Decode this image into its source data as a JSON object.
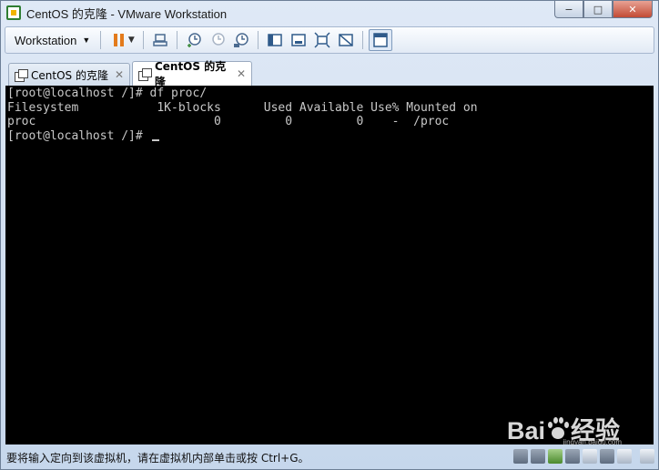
{
  "window": {
    "title": "CentOS 的克隆 - VMware Workstation",
    "controls": {
      "minimize": "−",
      "maximize": "□",
      "close": "✕"
    }
  },
  "toolbar": {
    "menu_label": "Workstation",
    "icons": [
      "pause-icon",
      "send-keys-icon",
      "snapshot-take-icon",
      "snapshot-revert-icon",
      "snapshot-manager-icon",
      "view-normal-icon",
      "view-fullscreen-bar-icon",
      "view-fit-icon",
      "view-unity-icon",
      "console-view-icon"
    ]
  },
  "tabs": [
    {
      "label": "CentOS 的克隆",
      "active": false,
      "close": "✕"
    },
    {
      "label": "CentOS 的克隆",
      "active": true,
      "close": "✕"
    }
  ],
  "console": {
    "lines": [
      "[root@localhost /]# df proc/",
      "Filesystem           1K-blocks      Used Available Use% Mounted on",
      "proc                         0         0         0    -  /proc",
      "[root@localhost /]# "
    ]
  },
  "statusbar": {
    "message": "要将输入定向到该虚拟机，请在虚拟机内部单击或按 Ctrl+G。",
    "icons": [
      "hdd-icon",
      "cdrom-icon",
      "network-icon",
      "usb-icon",
      "printer-icon",
      "sound-icon",
      "display-icon",
      "message-icon"
    ]
  },
  "watermark": {
    "brand_left": "Bai",
    "brand_right": "经验",
    "url": "jingyan.baidu.com"
  },
  "colors": {
    "console_bg": "#000000",
    "console_fg": "#c8c8c8",
    "pause_orange": "#e37b1c",
    "close_red": "#c24b35"
  }
}
